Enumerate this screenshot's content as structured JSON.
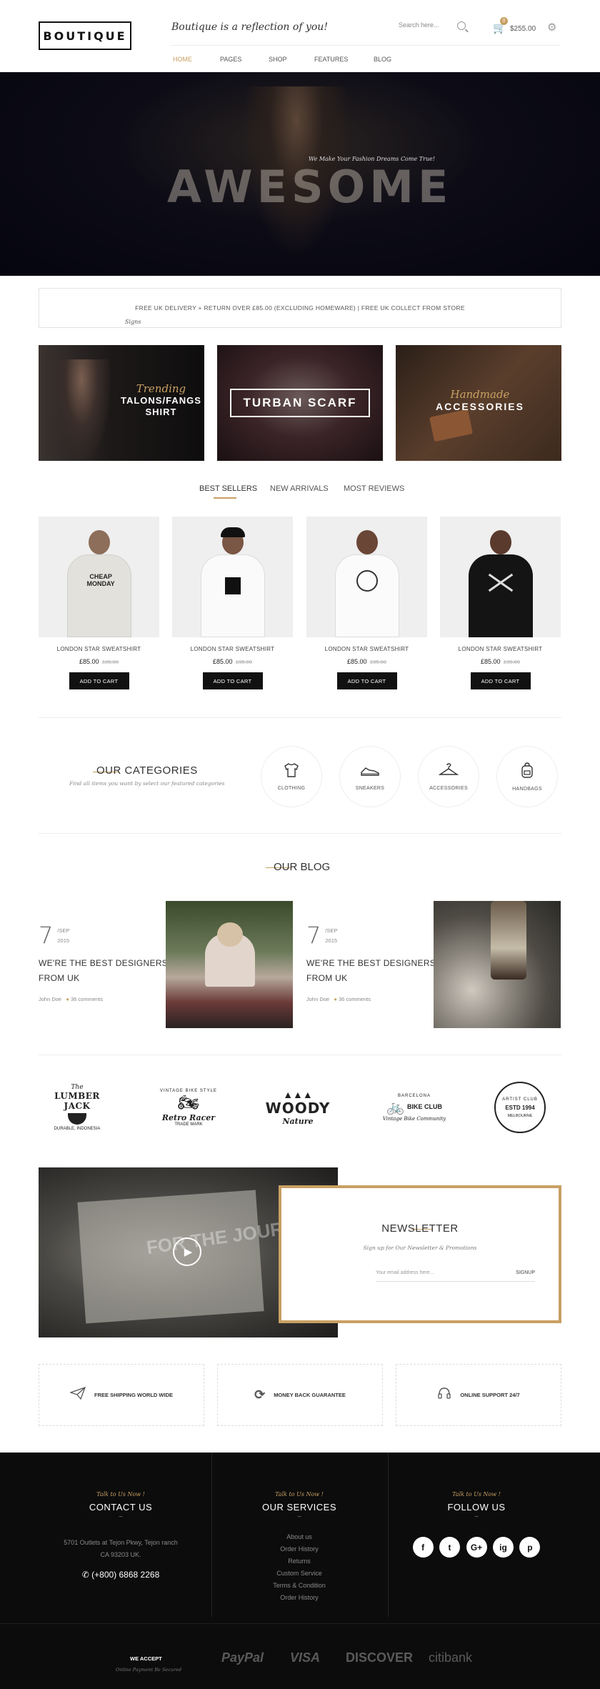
{
  "header": {
    "logo": "BOUTIQUE",
    "tagline": "Boutique is a reflection of you!",
    "search_placeholder": "Search here...",
    "cart_count": "0",
    "cart_total": "$255.00",
    "nav": [
      "HOME",
      "PAGES",
      "SHOP",
      "FEATURES",
      "BLOG"
    ]
  },
  "hero": {
    "subtitle": "We Make Your Fashion Dreams Come True!",
    "title": "AWESOME"
  },
  "delivery": {
    "text": "FREE UK DELIVERY + RETURN OVER £85.00 (EXCLUDING HOMEWARE) | FREE UK COLLECT FROM STORE",
    "signature": "Signs"
  },
  "promos": [
    {
      "script": "Trending",
      "line1": "TALONS/FANGS",
      "line2": "SHIRT"
    },
    {
      "label": "TURBAN SCARF"
    },
    {
      "script": "Handmade",
      "line1": "ACCESSORIES"
    }
  ],
  "tabs": [
    "BEST SELLERS",
    "NEW ARRIVALS",
    "MOST REVIEWS"
  ],
  "products": [
    {
      "name": "LONDON STAR SWEATSHIRT",
      "price": "£85.00",
      "old_price": "£95.00",
      "button": "ADD TO CART",
      "shirt": "#e6e6e2",
      "print": "CHEAP\nMONDAY"
    },
    {
      "name": "LONDON STAR SWEATSHIRT",
      "price": "£85.00",
      "old_price": "£95.00",
      "button": "ADD TO CART",
      "shirt": "#f8f8f8",
      "print": ""
    },
    {
      "name": "LONDON STAR SWEATSHIRT",
      "price": "£85.00",
      "old_price": "£95.00",
      "button": "ADD TO CART",
      "shirt": "#fafafa",
      "print": ""
    },
    {
      "name": "LONDON STAR SWEATSHIRT",
      "price": "£85.00",
      "old_price": "£95.00",
      "button": "ADD TO CART",
      "shirt": "#141414",
      "print": ""
    }
  ],
  "categories": {
    "title": "OUR CATEGORIES",
    "subtitle": "Find all items you want by select our featured categories",
    "items": [
      {
        "label": "CLOTHING",
        "icon": "tshirt-icon"
      },
      {
        "label": "SNEAKERS",
        "icon": "sneaker-icon"
      },
      {
        "label": "ACCESSORIES",
        "icon": "hanger-icon"
      },
      {
        "label": "HANDBAGS",
        "icon": "backpack-icon"
      }
    ]
  },
  "blog": {
    "title": "OUR BLOG",
    "posts": [
      {
        "day": "7",
        "month": "/SEP",
        "year": "2015",
        "title_line1": "WE'RE THE BEST DESIGNERS",
        "title_line2": "FROM UK",
        "author": "John Doe",
        "comments": "36 comments"
      },
      {
        "day": "7",
        "month": "/SEP",
        "year": "2015",
        "title_line1": "WE'RE THE BEST DESIGNERS",
        "title_line2": "FROM UK",
        "author": "John Doe",
        "comments": "36 comments"
      }
    ]
  },
  "brands": [
    {
      "top": "The",
      "main": "LUMBER JACK",
      "bottom": "DURABLE, INDONESIA"
    },
    {
      "top": "VINTAGE BIKE STYLE",
      "main": "Retro Racer",
      "bottom": "TRADE MARK"
    },
    {
      "top": "",
      "main": "WOODY",
      "bottom": "Nature"
    },
    {
      "top": "BARCELONA",
      "main": "BIKE CLUB",
      "bottom": "Vintage Bike Community"
    },
    {
      "top": "ARTIST CLUB",
      "main": "ESTD 1994",
      "bottom": "MELBOURNE"
    }
  ],
  "video": {
    "overlay": "FOR THE JOURNEY"
  },
  "newsletter": {
    "title": "NEWSLETTER",
    "subtitle": "Sign up for Our Newsletter & Promotions",
    "placeholder": "Your email address here...",
    "button": "SIGNUP"
  },
  "services": [
    {
      "label": "FREE SHIPPING WORLD WIDE",
      "icon": "paper-plane-icon"
    },
    {
      "label": "MONEY BACK GUARANTEE",
      "icon": "refresh-icon"
    },
    {
      "label": "ONLINE SUPPORT 24/7",
      "icon": "headphones-icon"
    }
  ],
  "footer": {
    "contact": {
      "script": "Talk to Us Now !",
      "title": "CONTACT US",
      "address1": "5701 Outlets at Tejon Pkwy, Tejon ranch",
      "address2": "CA 93203 UK.",
      "phone": "(+800) 6868 2268"
    },
    "services": {
      "script": "Talk to Us Now !",
      "title": "OUR SERVICES",
      "links": [
        "About us",
        "Order History",
        "Returns",
        "Custom Service",
        "Terms & Condition",
        "Order History"
      ]
    },
    "follow": {
      "script": "Talk to Us Now !",
      "title": "FOLLOW US",
      "icons": [
        "f",
        "t",
        "G+",
        "ig",
        "p"
      ]
    },
    "accept_title": "WE ACCEPT",
    "accept_sub": "Online Payment Be Secured",
    "payments": [
      "PayPal",
      "VISA",
      "DISCOVER",
      "citibank"
    ]
  }
}
